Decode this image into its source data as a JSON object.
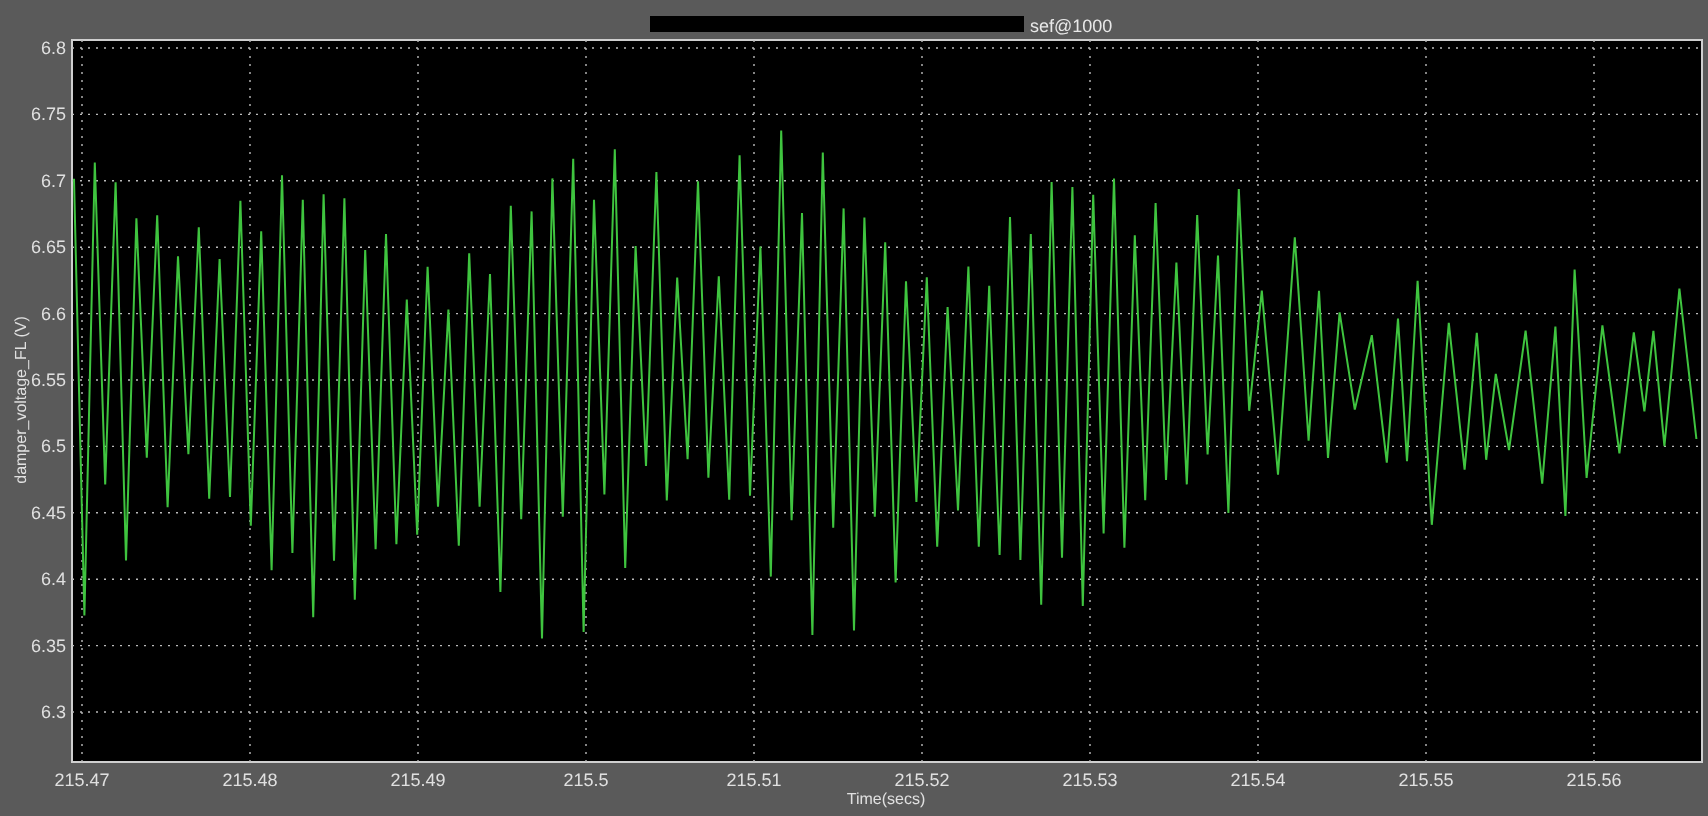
{
  "plot": {
    "title": "sef@1000",
    "ylabel": "damper_voltage_FL (V)",
    "xlabel": "Time(secs)",
    "yticks": [
      "6.8",
      "6.75",
      "6.7",
      "6.65",
      "6.6",
      "6.55",
      "6.5",
      "6.45",
      "6.4",
      "6.35",
      "6.3"
    ],
    "xticks": [
      "215.47",
      "215.48",
      "215.49",
      "215.5",
      "215.51",
      "215.52",
      "215.53",
      "215.54",
      "215.55",
      "215.56"
    ]
  }
}
